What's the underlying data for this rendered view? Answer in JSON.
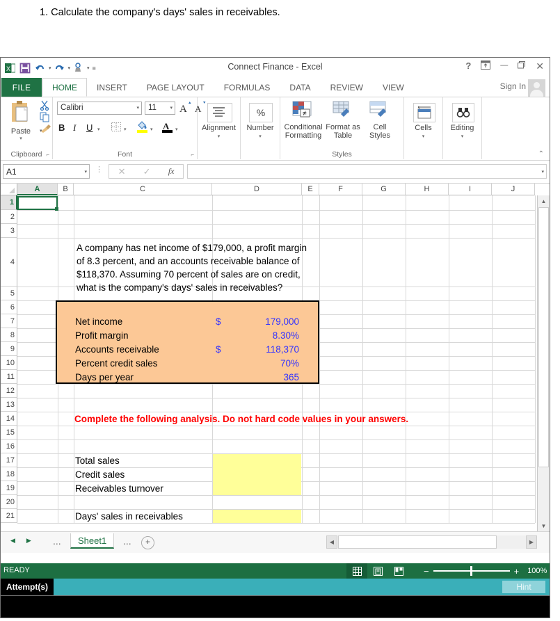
{
  "question": {
    "text": "1. Calculate the company's days' sales in receivables."
  },
  "window": {
    "title": "Connect Finance - Excel",
    "quick_access": [
      "save-icon",
      "undo-icon",
      "redo-icon",
      "touch-mode-icon",
      "customize-qat-icon"
    ],
    "controls": {
      "help": "?",
      "ribbon_display": "ribbon-display-icon",
      "minimize": "—",
      "restore": "❐",
      "close": "✕"
    },
    "sign_in": "Sign In"
  },
  "ribbon": {
    "file_tab": "FILE",
    "tabs": [
      {
        "label": "HOME",
        "active": true
      },
      {
        "label": "INSERT",
        "active": false
      },
      {
        "label": "PAGE LAYOUT",
        "active": false
      },
      {
        "label": "FORMULAS",
        "active": false
      },
      {
        "label": "DATA",
        "active": false
      },
      {
        "label": "REVIEW",
        "active": false
      },
      {
        "label": "VIEW",
        "active": false
      }
    ],
    "groups": [
      {
        "name": "Clipboard",
        "label": "Clipboard"
      },
      {
        "name": "Font",
        "label": "Font"
      },
      {
        "name": "Alignment",
        "label": "Alignment"
      },
      {
        "name": "Number",
        "label": "Number"
      },
      {
        "name": "Styles",
        "label": "Styles"
      },
      {
        "name": "Cells",
        "label": ""
      },
      {
        "name": "Editing",
        "label": ""
      }
    ],
    "clipboard": {
      "paste": "Paste",
      "cut": "cut-icon",
      "copy": "copy-icon",
      "format_painter": "format-painter-icon"
    },
    "font": {
      "family": "Calibri",
      "size": "11",
      "grow": "A",
      "shrink": "A",
      "bold": "B",
      "italic": "I",
      "underline": "U",
      "borders": "borders-icon",
      "fill": "fill-color-icon",
      "font_color": "font-color-icon"
    },
    "alignment": {
      "label": "Alignment",
      "icon": "align-icon"
    },
    "number": {
      "label": "Number",
      "icon": "%"
    },
    "styles": {
      "conditional_formatting": "Conditional Formatting",
      "format_as_table": "Format as Table",
      "cell_styles": "Cell Styles"
    },
    "cells": {
      "label": "Cells"
    },
    "editing": {
      "label": "Editing"
    },
    "collapse": "collapse-ribbon-icon"
  },
  "formula_bar": {
    "name_box": "A1",
    "cancel": "✕",
    "enter": "✓",
    "insert_function": "fx",
    "value": ""
  },
  "grid": {
    "columns": [
      "A",
      "B",
      "C",
      "D",
      "E",
      "F",
      "G",
      "H",
      "I",
      "J"
    ],
    "rows": [
      "1",
      "2",
      "3",
      "4",
      "5",
      "6",
      "7",
      "8",
      "9",
      "10",
      "11",
      "12",
      "13",
      "14",
      "15",
      "16",
      "17",
      "18",
      "19",
      "20",
      "21"
    ],
    "selected_cell": "A1",
    "cells": {
      "problem_statement": "A company has net income of $179,000, a profit margin of 8.3 percent, and an accounts receivable balance of $118,370. Assuming 70 percent of sales are on credit, what is the company's days' sales in receivables?",
      "instruction": "Complete the following analysis. Do not hard code values in your answers.",
      "inputs": [
        {
          "label": "Net income",
          "symbol": "$",
          "value": "179,000"
        },
        {
          "label": "Profit margin",
          "symbol": "",
          "value": "8.30%"
        },
        {
          "label": "Accounts receivable",
          "symbol": "$",
          "value": "118,370"
        },
        {
          "label": "Percent credit sales",
          "symbol": "",
          "value": "70%"
        },
        {
          "label": "Days per year",
          "symbol": "",
          "value": "365"
        }
      ],
      "answers": [
        {
          "label": "Total sales",
          "value": ""
        },
        {
          "label": "Credit sales",
          "value": ""
        },
        {
          "label": "Receivables turnover",
          "value": ""
        },
        {
          "label": "Days' sales in receivables",
          "value": ""
        }
      ]
    },
    "colors": {
      "input_box_fill": "#fcc896",
      "input_box_border": "#000000",
      "input_value_text": "#3333ff",
      "instruction_text": "#ff0000",
      "answer_fill": "#ffff99"
    }
  },
  "sheet_tabs": {
    "prev": "◀",
    "next": "▶",
    "first_ellipsis": "...",
    "tabs": [
      "Sheet1"
    ],
    "second_ellipsis": "...",
    "add_sheet": "+"
  },
  "status_bar": {
    "mode": "READY",
    "view_normal": "normal-view-icon",
    "view_page_layout": "page-layout-view-icon",
    "view_page_break": "page-break-view-icon",
    "zoom_out": "−",
    "zoom_in": "+",
    "zoom_level": "100%"
  },
  "attempt_bar": {
    "label": "Attempt(s)",
    "hint": "Hint"
  }
}
